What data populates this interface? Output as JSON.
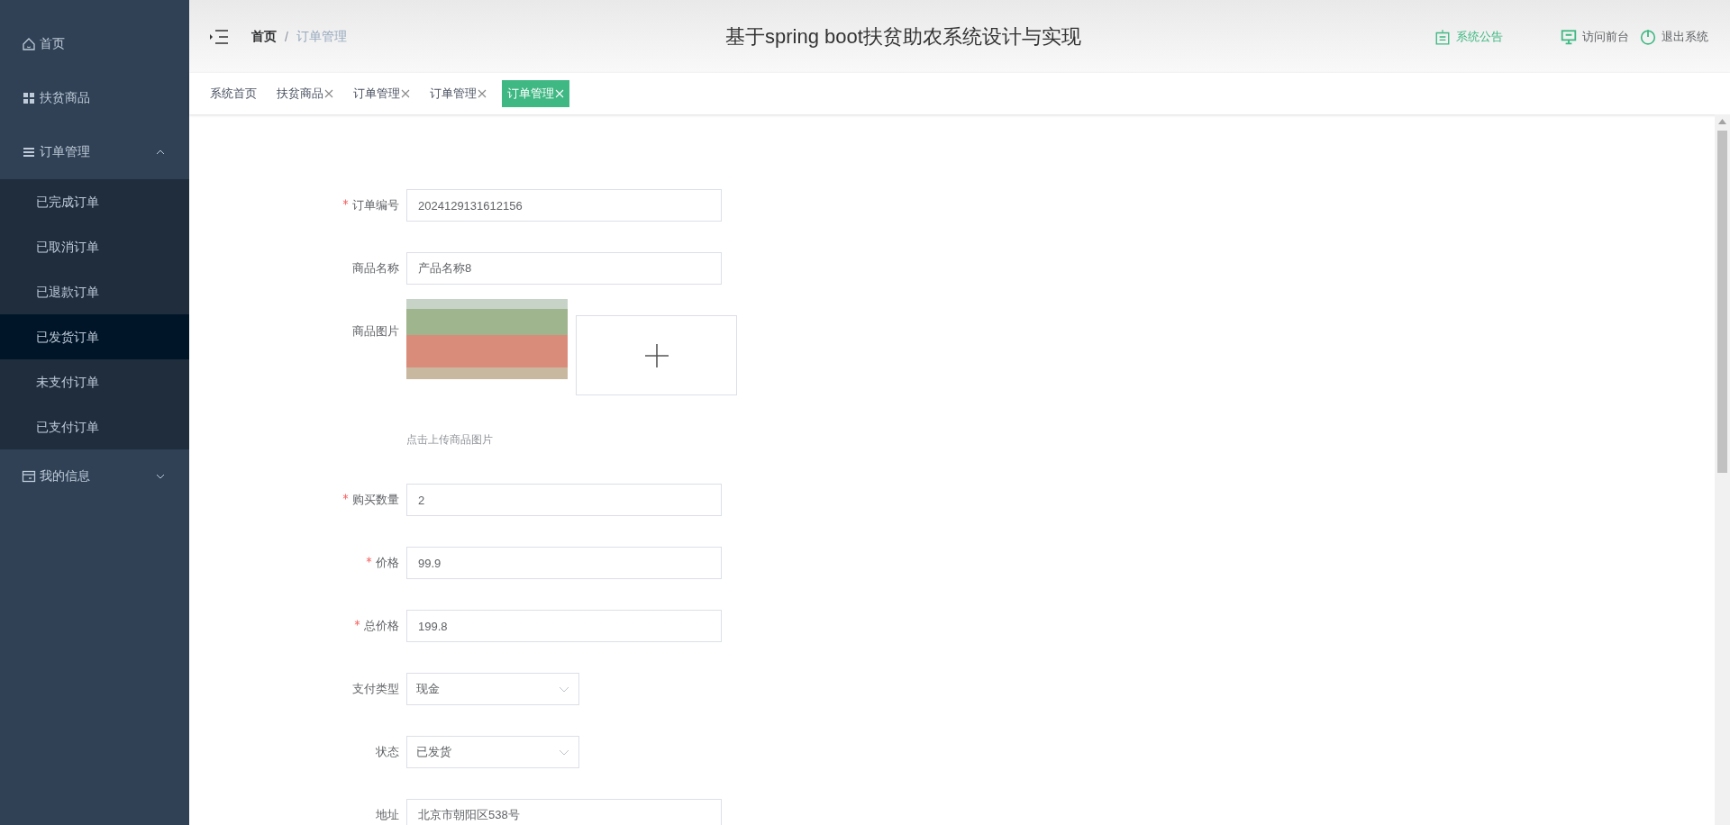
{
  "sidebar": {
    "items": [
      {
        "label": "首页"
      },
      {
        "label": "扶贫商品"
      },
      {
        "label": "订单管理",
        "expanded": true,
        "children": [
          {
            "label": "已完成订单",
            "selected": false
          },
          {
            "label": "已取消订单",
            "selected": false
          },
          {
            "label": "已退款订单",
            "selected": false
          },
          {
            "label": "已发货订单",
            "selected": true
          },
          {
            "label": "未支付订单",
            "selected": false
          },
          {
            "label": "已支付订单",
            "selected": false
          }
        ]
      },
      {
        "label": "我的信息",
        "expanded": false
      }
    ]
  },
  "header": {
    "breadcrumb": [
      "首页",
      "订单管理"
    ],
    "separator": "/",
    "title": "基于spring boot扶贫助农系统设计与实现",
    "actions": [
      {
        "label": "系统公告",
        "color": "#3fb883"
      },
      {
        "label": "访问前台",
        "color": "#606266"
      },
      {
        "label": "退出系统",
        "color": "#606266"
      }
    ]
  },
  "tabs": [
    {
      "label": "系统首页",
      "closable": false,
      "selected": false
    },
    {
      "label": "扶贫商品",
      "closable": true,
      "selected": false
    },
    {
      "label": "订单管理",
      "closable": true,
      "selected": false
    },
    {
      "label": "订单管理",
      "closable": true,
      "selected": false
    },
    {
      "label": "订单管理",
      "closable": true,
      "selected": true
    }
  ],
  "form": {
    "fields": [
      {
        "kind": "text",
        "label": "订单编号",
        "required": true,
        "value": "2024129131612156"
      },
      {
        "kind": "text",
        "label": "商品名称",
        "required": false,
        "value": "产品名称8"
      },
      {
        "kind": "image",
        "label": "商品图片",
        "required": false,
        "hint": "点击上传商品图片"
      },
      {
        "kind": "text",
        "label": "购买数量",
        "required": true,
        "value": "2"
      },
      {
        "kind": "text",
        "label": "价格",
        "required": true,
        "value": "99.9"
      },
      {
        "kind": "text",
        "label": "总价格",
        "required": true,
        "value": "199.8"
      },
      {
        "kind": "select",
        "label": "支付类型",
        "required": false,
        "value": "现金"
      },
      {
        "kind": "select",
        "label": "状态",
        "required": false,
        "value": "已发货"
      },
      {
        "kind": "text",
        "label": "地址",
        "required": false,
        "value": "北京市朝阳区538号"
      }
    ]
  }
}
